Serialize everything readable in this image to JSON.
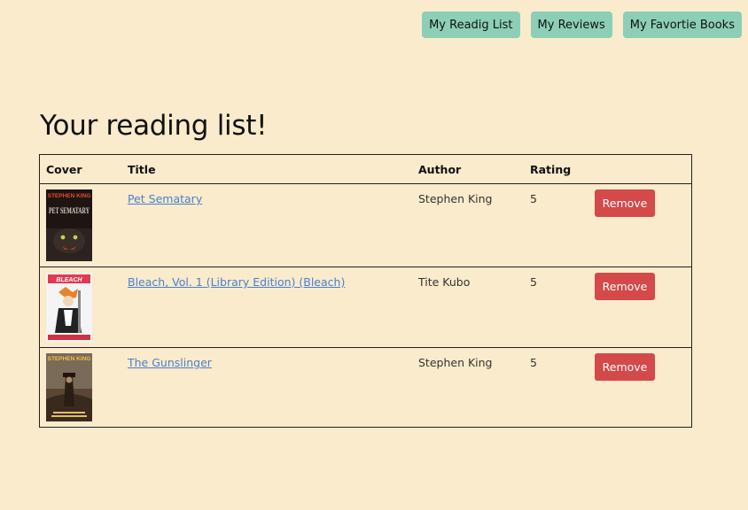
{
  "nav": {
    "reading_list": "My Readig List",
    "reviews": "My Reviews",
    "favorite_books": "My Favortie Books"
  },
  "heading": "Your reading list!",
  "table": {
    "headers": {
      "cover": "Cover",
      "title": "Title",
      "author": "Author",
      "rating": "Rating"
    },
    "rows": [
      {
        "title": "Pet Sematary",
        "author": "Stephen King",
        "rating": "5",
        "action": "Remove",
        "cover": {
          "author_text": "STEPHEN KING",
          "title_text": "PET SEMATARY",
          "bg": "#1e1412",
          "title_color": "#d8d0c4",
          "author_color": "#e84a2a"
        }
      },
      {
        "title": "Bleach, Vol. 1 (Library Edition) (Bleach)",
        "author": "Tite Kubo",
        "rating": "5",
        "action": "Remove",
        "cover": {
          "title_text": "BLEACH",
          "bg": "#f4f4f4",
          "accent": "#e7822e"
        }
      },
      {
        "title": "The Gunslinger",
        "author": "Stephen King",
        "rating": "5",
        "action": "Remove",
        "cover": {
          "author_text": "STEPHEN KING",
          "bg": "#5b4533",
          "author_color": "#f0c24a"
        }
      }
    ]
  }
}
